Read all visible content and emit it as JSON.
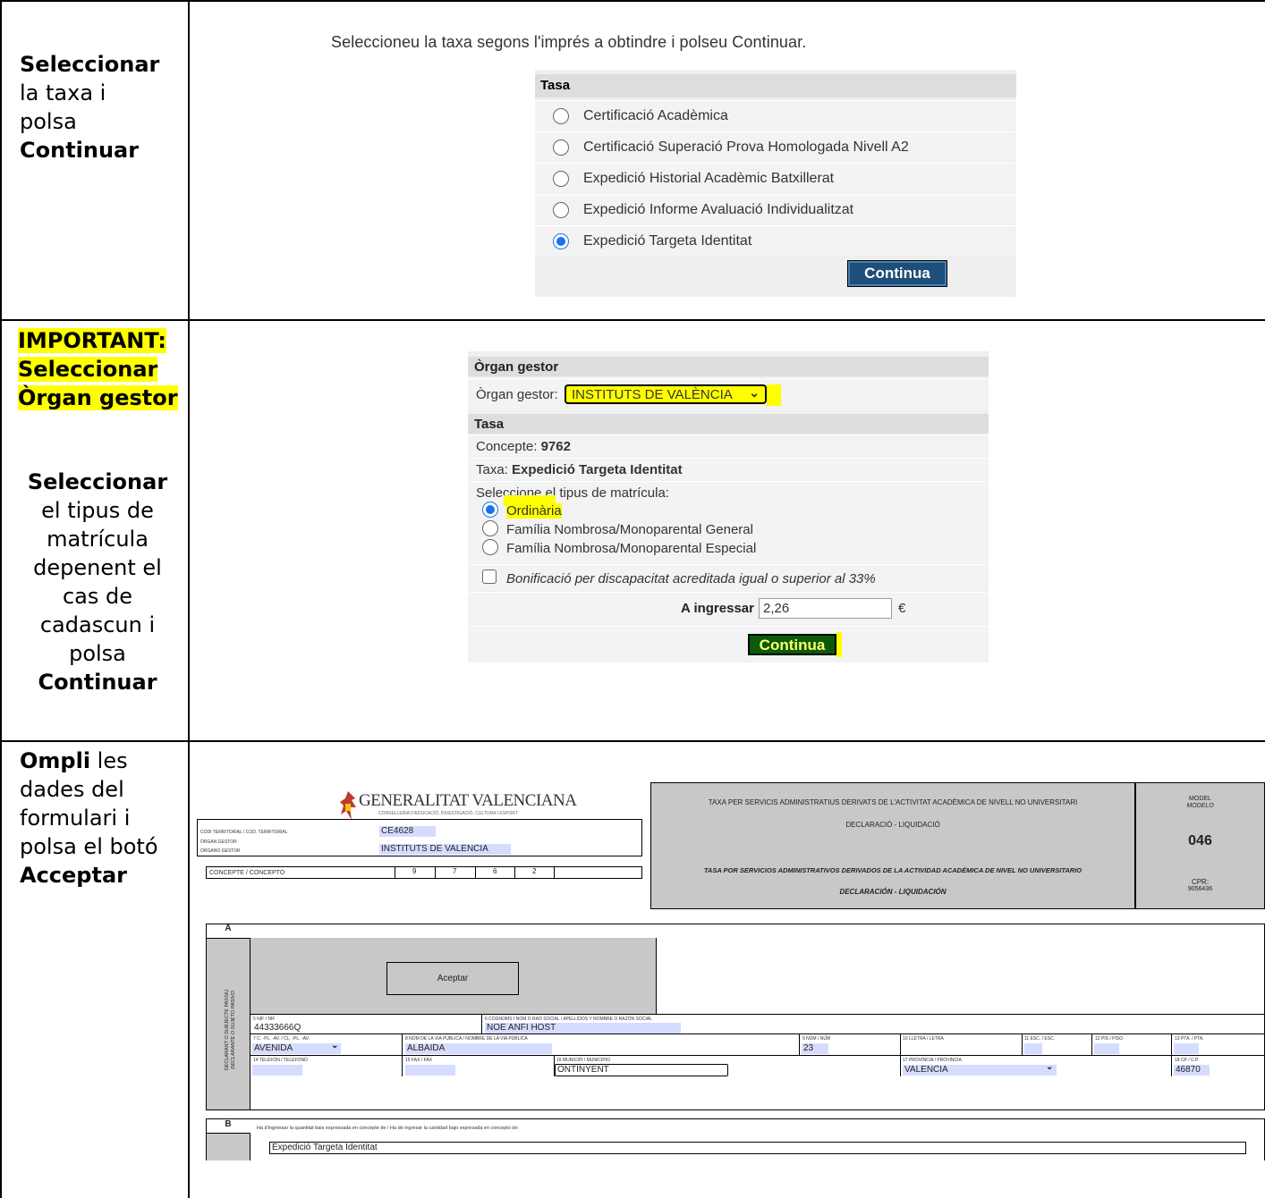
{
  "left_column": {
    "step1": {
      "bold1": "Seleccionar",
      "l2": "la taxa i",
      "l3": "polsa",
      "bold2": "Continuar"
    },
    "step2": {
      "important": "IMPORTANT:",
      "sel": "Seleccionar",
      "organ": "Òrgan gestor",
      "bold1": "Seleccionar",
      "l2": "el tipus de",
      "l3": "matrícula",
      "l4": "depenent el",
      "l5": "cas de",
      "l6": "cadascun i",
      "l7": "polsa",
      "bold2": "Continuar"
    },
    "step3": {
      "bold1": "Ompli",
      "l1rest": " les",
      "l2": "dades del",
      "l3": "formulari i",
      "l4": "polsa el botó",
      "bold2": "Acceptar"
    }
  },
  "panel1": {
    "title": "Seleccioneu la taxa segons l'imprés a obtindre i polseu Continuar.",
    "header": "Tasa",
    "options": [
      {
        "label": "Certificació Acadèmica",
        "selected": false
      },
      {
        "label": "Certificació Superació Prova Homologada Nivell A2",
        "selected": false
      },
      {
        "label": "Expedició Historial Acadèmic Batxillerat",
        "selected": false
      },
      {
        "label": "Expedició Informe Avaluació Individualitzat",
        "selected": false
      },
      {
        "label": "Expedició Targeta Identitat",
        "selected": true
      }
    ],
    "button": "Continua"
  },
  "panel2": {
    "organ_header": "Òrgan gestor",
    "organ_label": "Òrgan gestor:",
    "organ_value": "INSTITUTS DE VALÈNCIA",
    "tasa_header": "Tasa",
    "concepte_label": "Concepte:",
    "concepte_value": "9762",
    "taxa_label": "Taxa:",
    "taxa_value": "Expedició Targeta Identitat",
    "matricula_label": "Seleccione el tipus de matrícula:",
    "matricula_options": [
      {
        "label": "Ordinària",
        "selected": true
      },
      {
        "label": "Família Nombrosa/Monoparental General",
        "selected": false
      },
      {
        "label": "Família Nombrosa/Monoparental Especial",
        "selected": false
      }
    ],
    "bonificacio": "Bonificació per discapacitat acreditada igual o superior al 33%",
    "ingressar_label": "A ingressar",
    "ingressar_value": "2,26",
    "currency": "€",
    "button": "Continua"
  },
  "panel3": {
    "logo_main": "GENERALITAT VALENCIANA",
    "logo_sub": "CONSELLERIA D'EDUCACIÓ, INVESTIGACIÓ, CULTURA I ESPORT",
    "codi_label": "CODI TERRITORIAL / COD. TERRITORIAL",
    "codi_value": "CE4628",
    "organ_label": "ÒRGAN GESTOR",
    "organo_label": "ÓRGANO GESTOR",
    "organ_value": "INSTITUTS DE VALENCIA",
    "concepte_label": "CONCEPTE / CONCEPTO",
    "concepte_digits": [
      "9",
      "7",
      "6",
      "2"
    ],
    "header_va1": "TAXA PER SERVICIS ADMINISTRATIUS DERIVATS DE L'ACTIVITAT ACADÈMICA DE NIVELL NO UNIVERSITARI",
    "header_va2": "DECLARACIÓ - LIQUIDACIÓ",
    "header_es1": "TASA POR SERVICIOS ADMINISTRATIVOS DERIVADOS DE LA ACTIVIDAD ACADÉMICA DE NIVEL NO UNIVERSITARIO",
    "header_es2": "DECLARACIÓN - LIQUIDACIÓN",
    "model_label": "MODEL",
    "modelo_label": "MODELO",
    "model_number": "046",
    "cpr_label": "CPR:",
    "cpr_value": "9056436",
    "section_a": "A",
    "declarant": "DECLARANT O SUBJECTE PASSIU",
    "declarante": "DECLARANTE O SUJETO PASIVO",
    "aceptar": "Aceptar",
    "f5_label": "5 NIF / NIF",
    "f5_value": "44333666Q",
    "f6_label": "6 COGNOMS I NOM O RAÓ SOCIAL / APELLIDOS Y NOMBRE O RAZÓN SOCIAL",
    "f6_value": "NOE ANFI HOST",
    "f7_label": "7 C. -PL. -AV. / CL. -PL. -AV.",
    "f7_value": "AVENIDA",
    "f8_label": "8 NOM DE LA VIA PÚBLICA / NOMBRE DE LA VÍA PÚBLICA",
    "f8_value": "ALBAIDA",
    "f9_label": "9 NÚM / NÚM",
    "f9_value": "23",
    "f10_label": "10 LLETRA / LETRA",
    "f11_label": "11 ESC. / ESC.",
    "f12_label": "12 PIS / PISO",
    "f13_label": "13 PTA. / PTA.",
    "f14_label": "14 TELÈFON / TELÉFONO",
    "f15_label": "15 FAX / FAX",
    "f16_label": "16 MUNICIPI / MUNICIPIO",
    "f16_value": "ONTINYENT",
    "f17_label": "17 PROVÍNCIA / PROVINCIA",
    "f17_value": "VALENCIA",
    "f18_label": "18 CP / C.P.",
    "f18_value": "46870",
    "section_b": "B",
    "b_text": "Ha d'ingressar la quantitat baix expressada en concepte de / Ha de ingresar la cantidad bajo expresada en concepto de:",
    "b_value": "Expedició Targeta Identitat"
  }
}
